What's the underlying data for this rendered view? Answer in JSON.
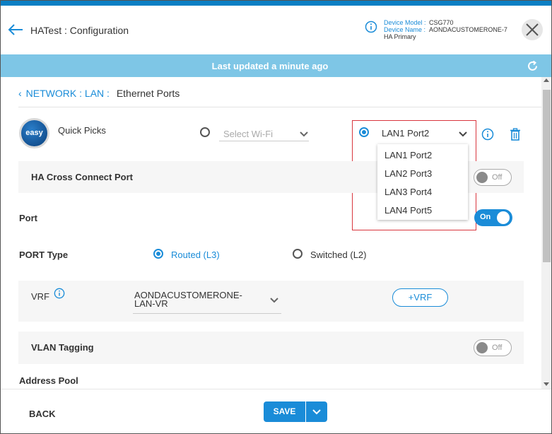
{
  "header": {
    "title": "HATest : Configuration",
    "device_model_label": "Device Model :",
    "device_model_value": "CSG770",
    "device_name_label": "Device Name :",
    "device_name_value": "AONDACUSTOMERONE-7",
    "ha_role": "HA Primary"
  },
  "banner": {
    "text": "Last updated a minute ago"
  },
  "breadcrumb": {
    "network": "NETWORK",
    "sep1": ":",
    "lan": "LAN",
    "sep2": ":",
    "current": "Ethernet Ports"
  },
  "quick_picks": {
    "logo_text": "easy",
    "label": "Quick Picks",
    "wifi_placeholder": "Select Wi-Fi",
    "lan_selected": "LAN1 Port2",
    "options": [
      "LAN1 Port2",
      "LAN2 Port3",
      "LAN3 Port4",
      "LAN4 Port5"
    ]
  },
  "ha_cross_connect": {
    "label": "HA Cross Connect Port",
    "toggle": "Off"
  },
  "port": {
    "label": "Port",
    "toggle": "On"
  },
  "port_type": {
    "label": "PORT Type",
    "routed": "Routed (L3)",
    "switched": "Switched (L2)"
  },
  "vrf": {
    "label": "VRF",
    "value": "AONDACUSTOMERONE-LAN-VR",
    "add_button": "+VRF"
  },
  "vlan": {
    "label": "VLAN Tagging",
    "toggle": "Off"
  },
  "address_pool": {
    "label": "Address Pool"
  },
  "footer": {
    "back": "BACK",
    "save": "SAVE"
  },
  "colors": {
    "accent": "#1a8cd8",
    "banner": "#7ec6e6",
    "topline": "#0b7fc4",
    "highlight_box": "#d9363e"
  }
}
